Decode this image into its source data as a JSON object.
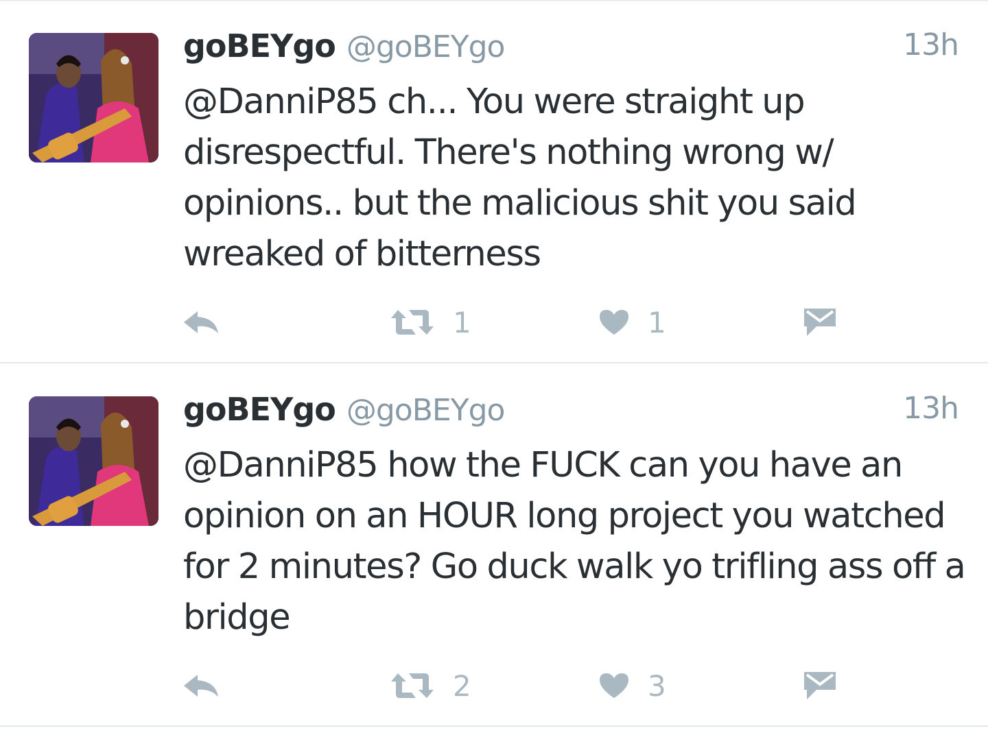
{
  "tweets": [
    {
      "display_name": "goBEYgo",
      "handle": "@goBEYgo",
      "time": "13h",
      "text": "@DanniP85 ch... You were straight up disrespectful. There's nothing wrong w/ opinions.. but the malicious shit you said wreaked of bitterness",
      "retweets": "1",
      "likes": "1",
      "avatar": "profile-photo"
    },
    {
      "display_name": "goBEYgo",
      "handle": "@goBEYgo",
      "time": "13h",
      "text": "@DanniP85 how the FUCK can you have an opinion on an HOUR long project you watched for 2 minutes? Go duck walk yo trifling ass off a bridge",
      "retweets": "2",
      "likes": "3",
      "avatar": "profile-photo"
    }
  ],
  "icons": {
    "reply": "reply-icon",
    "retweet": "retweet-icon",
    "like": "heart-icon",
    "message": "envelope-icon"
  },
  "colors": {
    "text": "#292f33",
    "muted": "#8899a6",
    "icon": "#aab8c2",
    "divider": "#e1e8ed"
  }
}
